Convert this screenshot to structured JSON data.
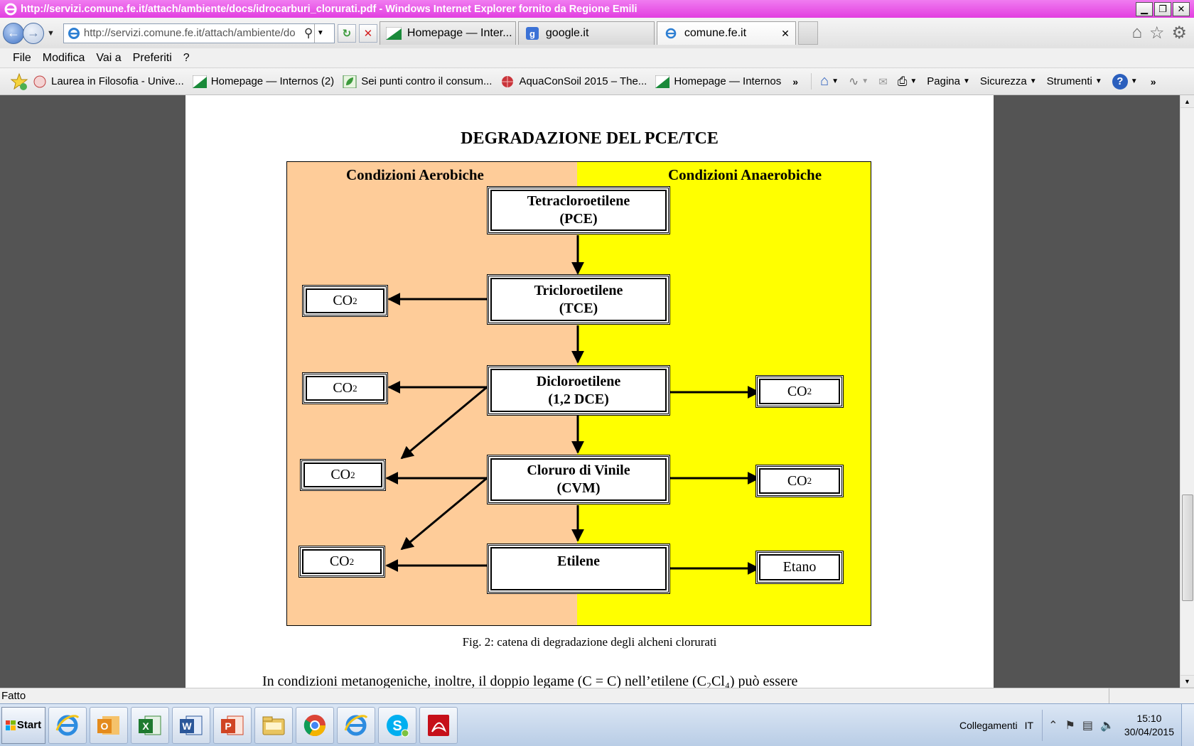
{
  "window": {
    "title": "http://servizi.comune.fe.it/attach/ambiente/docs/idrocarburi_clorurati.pdf - Windows Internet Explorer fornito da Regione Emili",
    "minimize_label": "▁",
    "restore_label": "❐",
    "close_label": "✕"
  },
  "navbar": {
    "address_value": "http://servizi.comune.fe.it/attach/ambiente/do",
    "tabs": [
      {
        "label": "Homepage — Inter...",
        "icon": "emilia-romagna-flag-icon"
      },
      {
        "label": "google.it",
        "icon": "google-icon"
      },
      {
        "label": "comune.fe.it",
        "icon": "ie-icon",
        "close": "✕"
      }
    ]
  },
  "menu": {
    "items": [
      "File",
      "Modifica",
      "Vai a",
      "Preferiti",
      "?"
    ]
  },
  "favorites": {
    "items": [
      {
        "label": "Laurea in Filosofia - Unive...",
        "icon": "university-seal-icon"
      },
      {
        "label": "Homepage — Internos (2)",
        "icon": "emilia-romagna-flag-icon"
      },
      {
        "label": "Sei punti contro il consum...",
        "icon": "leaf-icon"
      },
      {
        "label": "AquaConSoil 2015 – The...",
        "icon": "globe-icon"
      },
      {
        "label": "Homepage — Internos",
        "icon": "emilia-romagna-flag-icon"
      }
    ],
    "commands": [
      "Pagina",
      "Sicurezza",
      "Strumenti"
    ]
  },
  "document": {
    "title": "DEGRADAZIONE DEL PCE/TCE",
    "diagram": {
      "aerobic_label": "Condizioni Aerobiche",
      "anaerobic_label": "Condizioni Anaerobiche",
      "aerobic_color": "#fecc99",
      "anaerobic_color": "#ffff00",
      "chain": [
        {
          "line1": "Tetracloroetilene",
          "line2": "(PCE)"
        },
        {
          "line1": "Tricloroetilene",
          "line2": "(TCE)"
        },
        {
          "line1": "Dicloroetilene",
          "line2": "(1,2 DCE)"
        },
        {
          "line1": "Cloruro di Vinile",
          "line2": "(CVM)"
        },
        {
          "line1": "Etilene",
          "line2": ""
        }
      ],
      "co2_base": "CO",
      "co2_sub": "2",
      "etano": "Etano"
    },
    "caption": "Fig. 2: catena di degradazione degli alcheni clorurati",
    "body_text": "In condizioni metanogeniche, inoltre, il doppio legame (C = C) nell’etilene (C₂Cl₄) può essere"
  },
  "status": {
    "text": "Fatto"
  },
  "taskbar": {
    "start_label": "Start",
    "links_label": "Collegamenti",
    "lang": "IT",
    "time": "15:10",
    "date": "30/04/2015",
    "apps": [
      "ie-icon",
      "outlook-icon",
      "excel-icon",
      "word-icon",
      "powerpoint-icon",
      "file-explorer-icon",
      "chrome-icon",
      "ie-icon",
      "skype-icon",
      "acrobat-icon"
    ]
  }
}
